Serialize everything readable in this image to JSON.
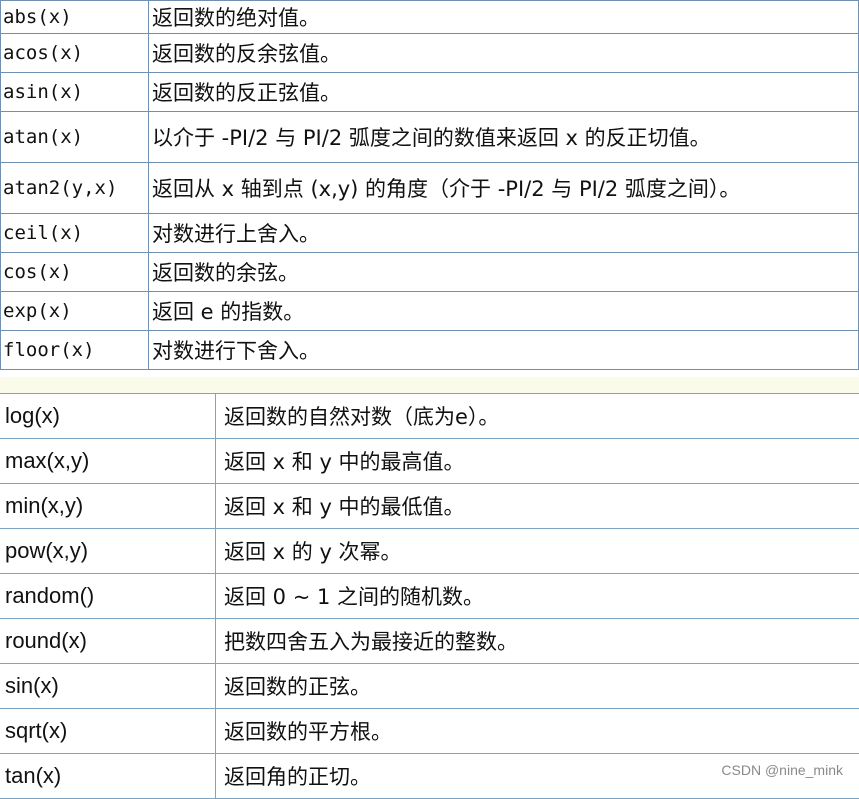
{
  "table1": {
    "rows": [
      {
        "fn": "abs(x)",
        "desc": "返回数的绝对值。"
      },
      {
        "fn": "acos(x)",
        "desc": "返回数的反余弦值。"
      },
      {
        "fn": "asin(x)",
        "desc": "返回数的反正弦值。"
      },
      {
        "fn": "atan(x)",
        "desc": "以介于 -PI/2 与 PI/2 弧度之间的数值来返回 x 的反正切值。"
      },
      {
        "fn": "atan2(y,x)",
        "desc": "返回从 x 轴到点 (x,y) 的角度（介于 -PI/2 与 PI/2 弧度之间）。"
      },
      {
        "fn": "ceil(x)",
        "desc": "对数进行上舍入。"
      },
      {
        "fn": "cos(x)",
        "desc": "返回数的余弦。"
      },
      {
        "fn": "exp(x)",
        "desc": "返回 e 的指数。"
      },
      {
        "fn": "floor(x)",
        "desc": "对数进行下舍入。"
      }
    ]
  },
  "table2": {
    "rows": [
      {
        "fn": "log(x)",
        "desc": "返回数的自然对数（底为e）。"
      },
      {
        "fn": "max(x,y)",
        "desc": "返回 x 和 y 中的最高值。"
      },
      {
        "fn": "min(x,y)",
        "desc": "返回 x 和 y 中的最低值。"
      },
      {
        "fn": "pow(x,y)",
        "desc": "返回 x 的 y 次幂。"
      },
      {
        "fn": "random()",
        "desc": "返回 0 ~ 1 之间的随机数。"
      },
      {
        "fn": "round(x)",
        "desc": "把数四舍五入为最接近的整数。"
      },
      {
        "fn": "sin(x)",
        "desc": "返回数的正弦。"
      },
      {
        "fn": "sqrt(x)",
        "desc": "返回数的平方根。"
      },
      {
        "fn": "tan(x)",
        "desc": "返回角的正切。"
      }
    ]
  },
  "watermark": "CSDN @nine_mink"
}
